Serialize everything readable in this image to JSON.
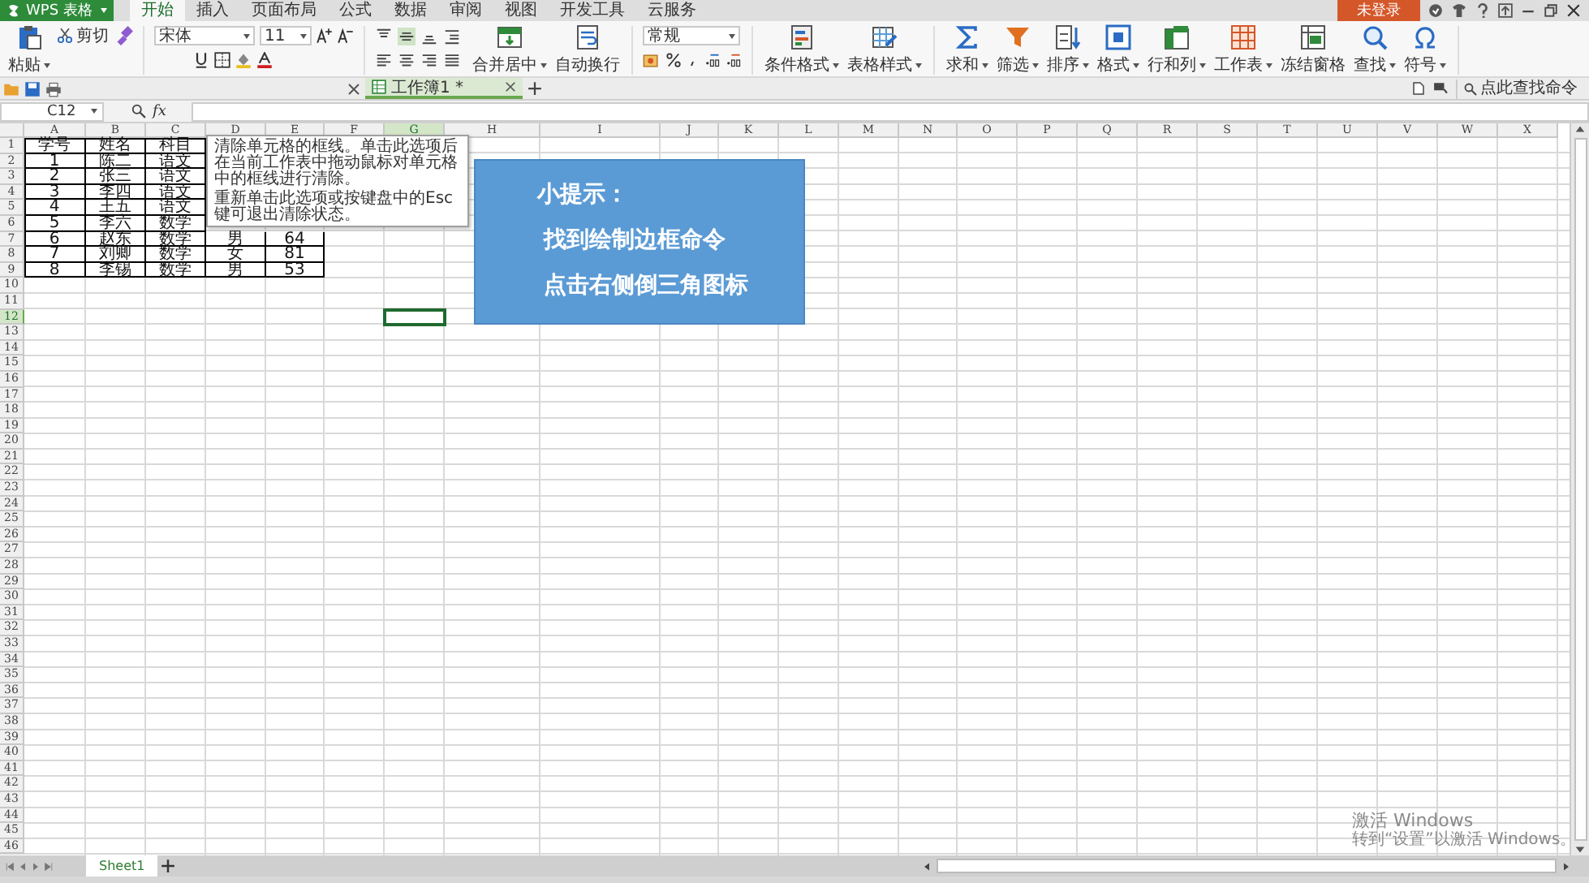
{
  "app_menu": {
    "label": "WPS 表格"
  },
  "menu_tabs": [
    {
      "label": "开始",
      "selected": true
    },
    {
      "label": "插入",
      "selected": false
    },
    {
      "label": "页面布局",
      "selected": false
    },
    {
      "label": "公式",
      "selected": false
    },
    {
      "label": "数据",
      "selected": false
    },
    {
      "label": "审阅",
      "selected": false
    },
    {
      "label": "视图",
      "selected": false
    },
    {
      "label": "开发工具",
      "selected": false
    },
    {
      "label": "云服务",
      "selected": false
    }
  ],
  "account": {
    "label": "未登录"
  },
  "ribbon": {
    "paste": {
      "label": "粘贴"
    },
    "cut": {
      "label": "剪切"
    },
    "font_name": {
      "value": "宋体"
    },
    "font_size": {
      "value": "11"
    },
    "number_format": {
      "value": "常规"
    },
    "buttons": [
      {
        "label": "合并居中",
        "dropdown": true
      },
      {
        "label": "自动换行",
        "dropdown": false
      },
      {
        "label": "条件格式",
        "dropdown": true
      },
      {
        "label": "表格样式",
        "dropdown": true
      },
      {
        "label": "求和",
        "dropdown": true
      },
      {
        "label": "筛选",
        "dropdown": true
      },
      {
        "label": "排序",
        "dropdown": true
      },
      {
        "label": "格式",
        "dropdown": true
      },
      {
        "label": "行和列",
        "dropdown": true
      },
      {
        "label": "工作表",
        "dropdown": true
      },
      {
        "label": "冻结窗格",
        "dropdown": false
      },
      {
        "label": "查找",
        "dropdown": true
      },
      {
        "label": "符号",
        "dropdown": true
      }
    ]
  },
  "command_search": {
    "placeholder": "点此查找命令"
  },
  "doc_tabs": [
    {
      "label": "工作簿1 *",
      "selected": true
    }
  ],
  "formula_bar": {
    "name_box": "C12",
    "function_label": "fx"
  },
  "grid": {
    "columns": [
      {
        "label": "A",
        "selected": false
      },
      {
        "label": "B",
        "selected": false
      },
      {
        "label": "C",
        "selected": false
      },
      {
        "label": "D",
        "selected": false
      },
      {
        "label": "E",
        "selected": false
      },
      {
        "label": "F",
        "selected": false
      },
      {
        "label": "G",
        "selected": true
      },
      {
        "label": "H",
        "selected": false
      },
      {
        "label": "I",
        "selected": false
      },
      {
        "label": "J",
        "selected": false
      },
      {
        "label": "K",
        "selected": false
      },
      {
        "label": "L",
        "selected": false
      },
      {
        "label": "M",
        "selected": false
      },
      {
        "label": "N",
        "selected": false
      },
      {
        "label": "O",
        "selected": false
      },
      {
        "label": "P",
        "selected": false
      },
      {
        "label": "Q",
        "selected": false
      },
      {
        "label": "R",
        "selected": false
      },
      {
        "label": "S",
        "selected": false
      },
      {
        "label": "T",
        "selected": false
      },
      {
        "label": "U",
        "selected": false
      },
      {
        "label": "V",
        "selected": false
      },
      {
        "label": "W",
        "selected": false
      },
      {
        "label": "X",
        "selected": false
      }
    ],
    "rows": [
      {
        "label": "1",
        "selected": false
      },
      {
        "label": "2",
        "selected": false
      },
      {
        "label": "3",
        "selected": false
      },
      {
        "label": "4",
        "selected": false
      },
      {
        "label": "5",
        "selected": false
      },
      {
        "label": "6",
        "selected": false
      },
      {
        "label": "7",
        "selected": false
      },
      {
        "label": "8",
        "selected": false
      },
      {
        "label": "9",
        "selected": false
      },
      {
        "label": "10",
        "selected": false
      },
      {
        "label": "11",
        "selected": false
      },
      {
        "label": "12",
        "selected": true
      },
      {
        "label": "13",
        "selected": false
      },
      {
        "label": "14",
        "selected": false
      },
      {
        "label": "15",
        "selected": false
      },
      {
        "label": "16",
        "selected": false
      },
      {
        "label": "17",
        "selected": false
      },
      {
        "label": "18",
        "selected": false
      },
      {
        "label": "19",
        "selected": false
      },
      {
        "label": "20",
        "selected": false
      },
      {
        "label": "21",
        "selected": false
      },
      {
        "label": "22",
        "selected": false
      },
      {
        "label": "23",
        "selected": false
      },
      {
        "label": "24",
        "selected": false
      },
      {
        "label": "25",
        "selected": false
      },
      {
        "label": "26",
        "selected": false
      },
      {
        "label": "27",
        "selected": false
      },
      {
        "label": "28",
        "selected": false
      },
      {
        "label": "29",
        "selected": false
      },
      {
        "label": "30",
        "selected": false
      },
      {
        "label": "31",
        "selected": false
      },
      {
        "label": "32",
        "selected": false
      },
      {
        "label": "33",
        "selected": false
      },
      {
        "label": "34",
        "selected": false
      },
      {
        "label": "35",
        "selected": false
      },
      {
        "label": "36",
        "selected": false
      },
      {
        "label": "37",
        "selected": false
      },
      {
        "label": "38",
        "selected": false
      },
      {
        "label": "39",
        "selected": false
      },
      {
        "label": "40",
        "selected": false
      },
      {
        "label": "41",
        "selected": false
      },
      {
        "label": "42",
        "selected": false
      },
      {
        "label": "43",
        "selected": false
      },
      {
        "label": "44",
        "selected": false
      },
      {
        "label": "45",
        "selected": false
      },
      {
        "label": "46",
        "selected": false
      }
    ],
    "data_rows": [
      {
        "cells": [
          "学号",
          "姓名",
          "科目"
        ]
      },
      {
        "cells": [
          "1",
          "陈二",
          "语文"
        ]
      },
      {
        "cells": [
          "2",
          "张三",
          "语文"
        ]
      },
      {
        "cells": [
          "3",
          "李四",
          "语文"
        ]
      },
      {
        "cells": [
          "4",
          "王五",
          "语文"
        ]
      },
      {
        "cells": [
          "5",
          "李六",
          "数学"
        ]
      },
      {
        "cells": [
          "6",
          "赵东",
          "数学",
          "男",
          "64"
        ]
      },
      {
        "cells": [
          "7",
          "刘卿",
          "数学",
          "女",
          "81"
        ]
      },
      {
        "cells": [
          "8",
          "李锡",
          "数学",
          "男",
          "53"
        ]
      }
    ]
  },
  "tooltip": {
    "paragraphs": [
      "清除单元格的框线。单击此选项后在当前工作表中拖动鼠标对单元格中的框线进行清除。",
      "重新单击此选项或按键盘中的Esc键可退出清除状态。"
    ]
  },
  "callout": {
    "title": "小提示：",
    "lines": [
      "找到绘制边框命令",
      "点击右侧倒三角图标"
    ]
  },
  "sheet_tabs": [
    {
      "label": "Sheet1",
      "selected": true
    }
  ],
  "activation_notice": {
    "title": "激活 Windows",
    "subtitle": "转到“设置”以激活 Windows。"
  }
}
